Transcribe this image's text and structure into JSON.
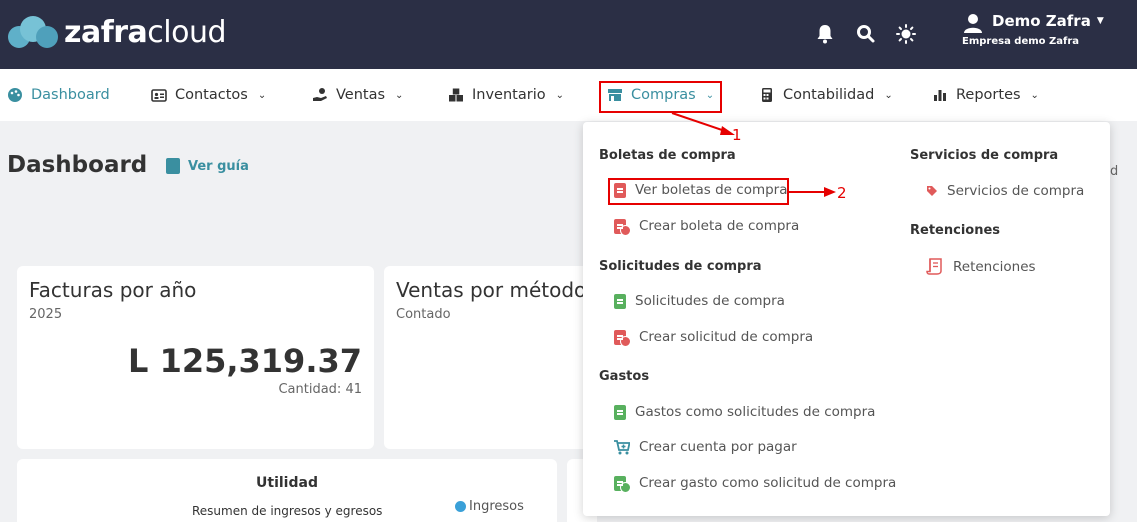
{
  "header": {
    "logo_bold": "zafra",
    "logo_light": "cloud",
    "user_name": "Demo Zafra",
    "company": "Empresa demo Zafra"
  },
  "nav": {
    "dashboard": "Dashboard",
    "contactos": "Contactos",
    "ventas": "Ventas",
    "inventario": "Inventario",
    "compras": "Compras",
    "contabilidad": "Contabilidad",
    "reportes": "Reportes"
  },
  "page": {
    "title": "Dashboard",
    "guide": "Ver guía",
    "partial_right": "d"
  },
  "cards": {
    "facturas": {
      "title": "Facturas por año",
      "year": "2025",
      "amount": "L 125,319.37",
      "count": "Cantidad: 41"
    },
    "ventas_metodo": {
      "title": "Ventas por método",
      "sub": "Contado"
    },
    "utilidad": {
      "title": "Utilidad",
      "sub": "Resumen de ingresos y egresos",
      "legend": "Ingresos"
    }
  },
  "dropdown": {
    "boletas_head": "Boletas de compra",
    "ver_boletas": "Ver boletas de compra",
    "crear_boleta": "Crear boleta de compra",
    "solicitudes_head": "Solicitudes de compra",
    "solicitudes": "Solicitudes de compra",
    "crear_solicitud": "Crear solicitud de compra",
    "gastos_head": "Gastos",
    "gastos_solicitudes": "Gastos como solicitudes de compra",
    "crear_cuenta": "Crear cuenta por pagar",
    "crear_gasto": "Crear gasto como solicitud de compra",
    "servicios_head": "Servicios de compra",
    "servicios": "Servicios de compra",
    "retenciones_head": "Retenciones",
    "retenciones": "Retenciones"
  },
  "annotations": {
    "one": "1",
    "two": "2"
  },
  "colors": {
    "header_bg": "#2b2f45",
    "accent": "#3a8fa0",
    "annotation_red": "#e60000"
  }
}
